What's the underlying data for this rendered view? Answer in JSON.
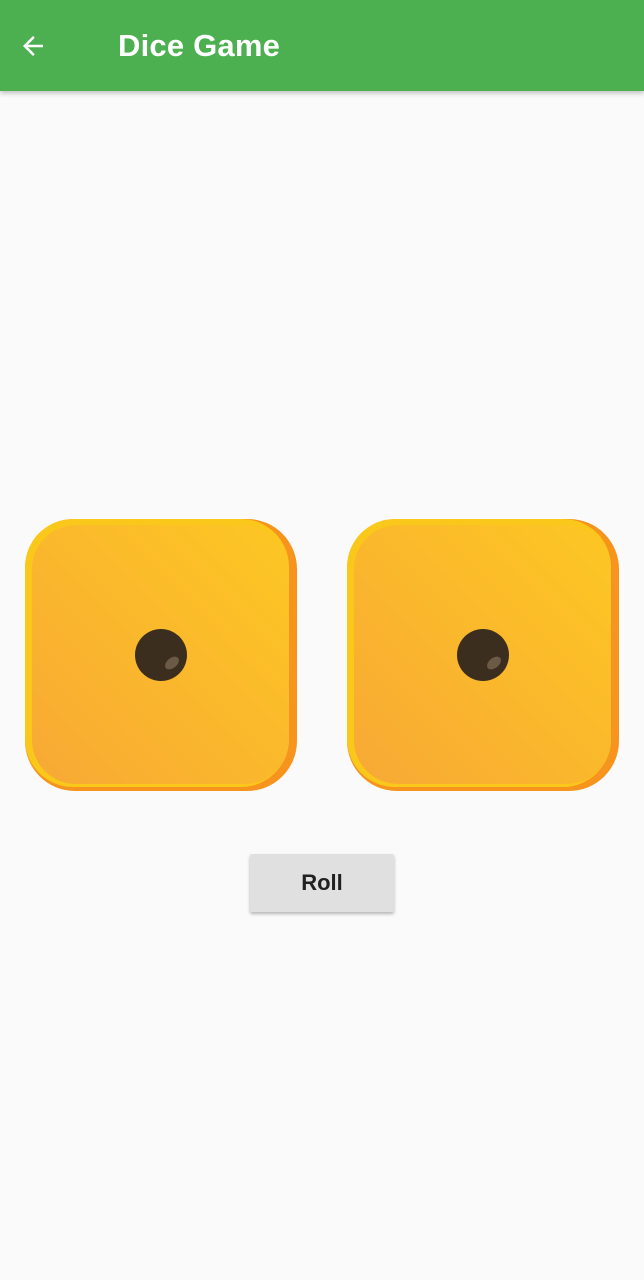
{
  "app_bar": {
    "title": "Dice Game",
    "back_icon": "arrow-back-icon",
    "background_color": "#4caf50"
  },
  "dice": [
    {
      "value": 1,
      "icon": "die-face-1-icon"
    },
    {
      "value": 1,
      "icon": "die-face-1-icon"
    }
  ],
  "dice_colors": {
    "face_light": "#fdc723",
    "face_dark": "#f8a935",
    "edge": "#f7941d",
    "pip": "#3b2e1f"
  },
  "roll_button": {
    "label": "Roll"
  }
}
